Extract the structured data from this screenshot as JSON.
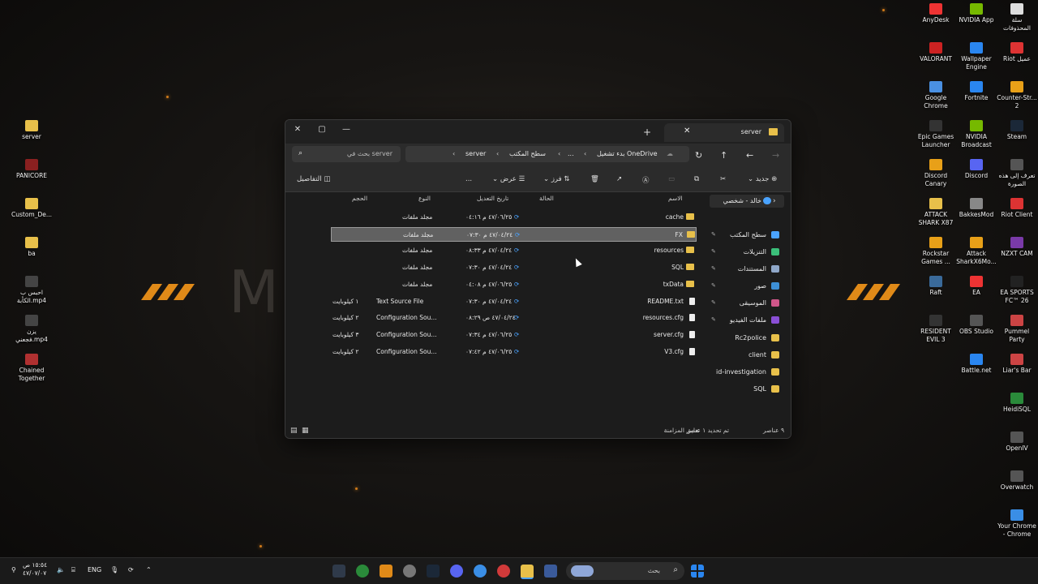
{
  "colors": {
    "folder": "#e8c04a",
    "accent": "#4aa3ff",
    "selected_row": "#616161"
  },
  "desktop_left": [
    {
      "label": "server"
    },
    {
      "label": "PANICORE"
    },
    {
      "label": "Custom_De..."
    },
    {
      "label": "ba"
    },
    {
      "label": "احبس ب\nالكأبة.mp4"
    },
    {
      "label": "يزن\nفجعني.mp4"
    },
    {
      "label": "Chained\nTogether"
    }
  ],
  "desktop_right": [
    {
      "label": "سلة\nالمحذوفات"
    },
    {
      "label": "NVIDIA App"
    },
    {
      "label": "AnyDesk"
    },
    {
      "label": "Riot عميل"
    },
    {
      "label": "Wallpaper\nEngine"
    },
    {
      "label": "VALORANT"
    },
    {
      "label": "Counter-Str...\n2"
    },
    {
      "label": "Fortnite"
    },
    {
      "label": "Google\nChrome"
    },
    {
      "label": "Steam"
    },
    {
      "label": "NVIDIA\nBroadcast"
    },
    {
      "label": "Epic Games\nLauncher"
    },
    {
      "label": "تعرف إلى هذه\nالصورة"
    },
    {
      "label": "Discord"
    },
    {
      "label": "Discord\nCanary"
    },
    {
      "label": "Riot Client"
    },
    {
      "label": "BakkesMod"
    },
    {
      "label": "ATTACK\nSHARK X87"
    },
    {
      "label": "NZXT CAM"
    },
    {
      "label": "Attack\nSharkX6Mo..."
    },
    {
      "label": "Rockstar\nGames ..."
    },
    {
      "label": "EA SPORTS\nFC™ 26"
    },
    {
      "label": "EA"
    },
    {
      "label": "Raft"
    },
    {
      "label": "Pummel\nParty"
    },
    {
      "label": "OBS Studio"
    },
    {
      "label": "RESIDENT\nEVIL 3"
    },
    {
      "label": "Liar's Bar"
    },
    {
      "label": "Battle.net"
    },
    {
      "label": "HeidiSQL"
    },
    {
      "label": "OpenIV"
    },
    {
      "label": "Overwatch"
    },
    {
      "label": "Your Chrome\n- Chrome"
    }
  ],
  "explorer": {
    "tab_title": "server",
    "breadcrumb": [
      "بدء تشغيل OneDrive",
      "...",
      "سطح المكتب",
      "server"
    ],
    "search_placeholder": "بحث في server",
    "toolbar": {
      "new": "جديد",
      "sort": "فرز",
      "view": "عرض",
      "more": "...",
      "details": "التفاصيل"
    },
    "columns": {
      "name": "الاسم",
      "status": "الحالة",
      "modified": "تاريخ التعديل",
      "type": "النوع",
      "size": "الحجم"
    },
    "rows": [
      {
        "name": "cache",
        "modified": "٤٧/٠٦/٢٥ م ٠٤:١٦",
        "type": "مجلد ملفات",
        "size": "",
        "kind": "folder"
      },
      {
        "name": "FX",
        "modified": "٤٧/٠٤/٢٤ م ٠٧:٣٠",
        "type": "مجلد ملفات",
        "size": "",
        "kind": "folder",
        "selected": true
      },
      {
        "name": "resources",
        "modified": "٤٧/٠٤/٢٤ م ٠٨:٣٣",
        "type": "مجلد ملفات",
        "size": "",
        "kind": "folder"
      },
      {
        "name": "SQL",
        "modified": "٤٧/٠٤/٢٤ م ٠٧:٣٠",
        "type": "مجلد ملفات",
        "size": "",
        "kind": "folder"
      },
      {
        "name": "txData",
        "modified": "٤٧/٠٦/٢٥ م ٠٤:٠٨",
        "type": "مجلد ملفات",
        "size": "",
        "kind": "folder"
      },
      {
        "name": "README.txt",
        "modified": "٤٧/٠٤/٢٤ م ٠٧:٣٠",
        "type": "Text Source File",
        "size": "١ كيلوبايت",
        "kind": "file"
      },
      {
        "name": "resources.cfg",
        "modified": "٤٧/٠٤/٢٤ ص ٠٨:٢٩",
        "type": "Configuration Sou...",
        "size": "٢ كيلوبايت",
        "kind": "file"
      },
      {
        "name": "server.cfg",
        "modified": "٤٧/٠٦/٢٥ م ٠٧:٣٤",
        "type": "Configuration Sou...",
        "size": "٣ كيلوبايت",
        "kind": "file"
      },
      {
        "name": "V3.cfg",
        "modified": "٤٧/٠٦/٢٥ م ٠٧:٤٢",
        "type": "Configuration Sou...",
        "size": "٢ كيلوبايت",
        "kind": "file"
      }
    ],
    "sidebar_top": "خالد - شخصي",
    "sidebar": [
      {
        "label": "سطح المكتب",
        "color": "#4aa3ff"
      },
      {
        "label": "التنزيلات",
        "color": "#3bbf7a"
      },
      {
        "label": "المستندات",
        "color": "#8fa7c8"
      },
      {
        "label": "صور",
        "color": "#3d8fd6"
      },
      {
        "label": "الموسيقى",
        "color": "#d0568a"
      },
      {
        "label": "ملفات الفيديو",
        "color": "#8a4fd6"
      },
      {
        "label": "Rc2police",
        "color": "#e8c04a"
      },
      {
        "label": "client",
        "color": "#e8c04a"
      },
      {
        "label": "id-investigation",
        "color": "#e8c04a"
      },
      {
        "label": "SQL",
        "color": "#e8c04a"
      }
    ],
    "status": {
      "count": "٩ عناصر",
      "selected": "تم تحديد ١ عنصر",
      "sync": "تعليق المزامنة"
    }
  },
  "taskbar": {
    "search_placeholder": "بحث",
    "lang": "ENG",
    "time": "١٥:٥٤ ص",
    "date": "٤٧/٠٧/٠٧"
  }
}
